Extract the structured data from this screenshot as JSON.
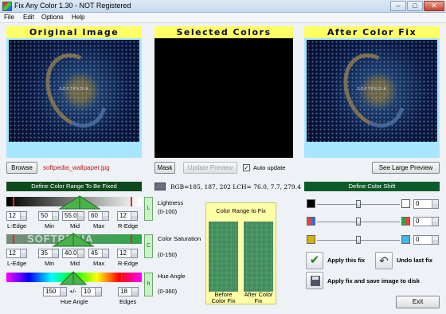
{
  "window": {
    "title": "Fix Any Color 1.30 - NOT Registered",
    "min": "‒",
    "max": "□",
    "close": "✕"
  },
  "menu": [
    "File",
    "Edit",
    "Options",
    "Help"
  ],
  "panels": {
    "original": "Original Image",
    "selected": "Selected Colors",
    "after": "After Color Fix"
  },
  "image_watermark": "SOFTPEDIA",
  "toolbar": {
    "browse": "Browse",
    "filename": "softpedia_wallpaper.jpg",
    "mask": "Mask",
    "update_preview": "Update Preview",
    "auto_update": "Auto update",
    "see_large_preview": "See Large Preview"
  },
  "left": {
    "header": "Define Color Range To Be Fixed",
    "lightness": {
      "values": [
        "12",
        "50",
        "55.0",
        "60",
        "12"
      ],
      "tab": "L",
      "title": "Lightness",
      "range": "(0-100)"
    },
    "saturation": {
      "values": [
        "12",
        "35",
        "40.0",
        "45",
        "12"
      ],
      "tab": "C",
      "title": "Color Saturation",
      "range": "(0-150)"
    },
    "hue": {
      "values": [
        "150",
        "10",
        "18"
      ],
      "tab": "h",
      "title": "Hue Angle",
      "range": "(0-360)",
      "angle_label": "Hue Angle",
      "edges_label": "Edges",
      "plusminus": "+/-"
    },
    "labels": {
      "l_edge": "L-Edge",
      "min": "Min",
      "mid": "Mid",
      "max": "Max",
      "r_edge": "R-Edge"
    },
    "watermark": "SOFTPEDIA"
  },
  "middle": {
    "rgb": "RGB=185, 187, 202  LCH= 76.0, 7.7, 279.4",
    "swatch_color": "#6b6f84",
    "range_title": "Color Range to Fix",
    "before": "Before Color Fix",
    "after": "After Color Fix"
  },
  "right": {
    "header": "Define Color Shift",
    "rows": [
      {
        "left_color": "#000000",
        "right_color": "#ffffff",
        "value": "0"
      },
      {
        "left_color": "#8a8a8a",
        "right_color": "#2fa64a",
        "value": "0"
      },
      {
        "left_color": "#d4b200",
        "right_color": "#3fb6e8",
        "value": "0"
      }
    ],
    "apply": "Apply this fix",
    "undo": "Undo last fix",
    "apply_save": "Apply fix and save image to disk",
    "exit": "Exit"
  }
}
